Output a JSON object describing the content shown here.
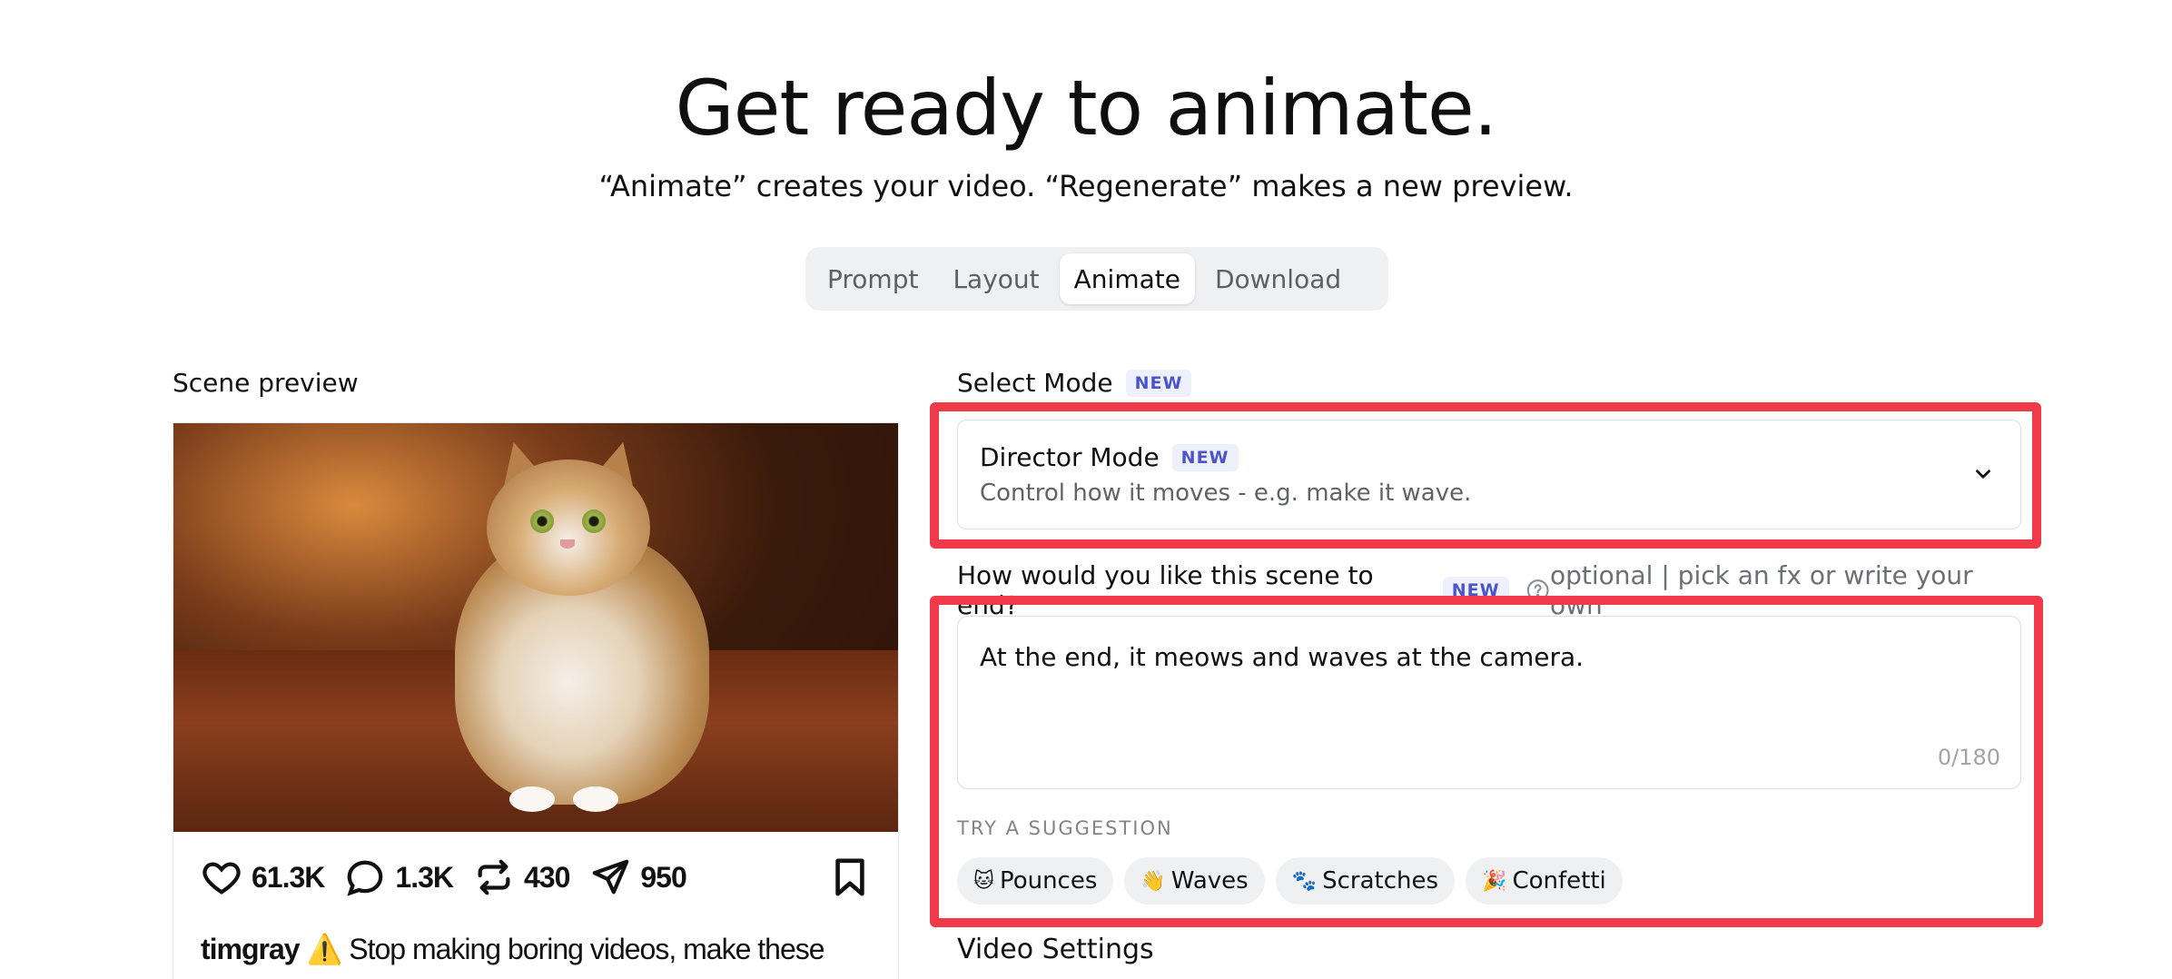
{
  "header": {
    "title": "Get ready to animate.",
    "subtitle": "“Animate” creates your video. “Regenerate” makes a new preview."
  },
  "tabs": [
    {
      "label": "Prompt",
      "active": false
    },
    {
      "label": "Layout",
      "active": false
    },
    {
      "label": "Animate",
      "active": true
    },
    {
      "label": "Download",
      "active": false
    }
  ],
  "preview": {
    "label": "Scene preview",
    "stats": {
      "likes": "61.3K",
      "comments": "1.3K",
      "reposts": "430",
      "shares": "950"
    },
    "caption_user": "timgray",
    "caption_icon": "⚠️",
    "caption_text": "Stop making boring videos, make these"
  },
  "mode": {
    "label": "Select Mode",
    "badge": "NEW",
    "selected_title": "Director Mode",
    "selected_badge": "NEW",
    "selected_desc": "Control how it moves - e.g. make it wave."
  },
  "ending": {
    "question": "How would you like this scene to end?",
    "badge": "NEW",
    "optional": "optional | pick an fx or write your own",
    "value": "At the end, it meows and waves at the camera.",
    "counter": "0/180"
  },
  "suggestions": {
    "label": "TRY A SUGGESTION",
    "items": [
      {
        "emoji": "🐱",
        "label": "Pounces"
      },
      {
        "emoji": "👋",
        "label": "Waves"
      },
      {
        "emoji": "🐾",
        "label": "Scratches"
      },
      {
        "emoji": "🎉",
        "label": "Confetti"
      }
    ]
  },
  "video_settings": {
    "label": "Video Settings"
  },
  "colors": {
    "highlight": "#f03a4a",
    "badge_text": "#4b55c9",
    "badge_bg": "#eef0fb"
  }
}
